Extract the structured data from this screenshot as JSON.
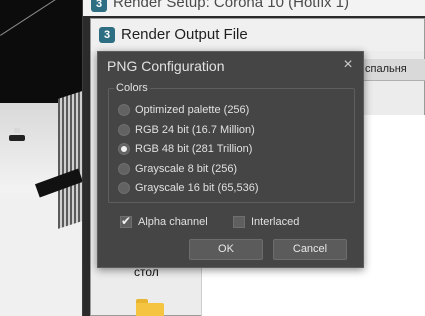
{
  "render_setup": {
    "title": "Render Setup: Corona 10 (Hotfix 1)",
    "icon_text": "3"
  },
  "render_output": {
    "title": "Render Output File",
    "icon_text": "3",
    "tab_text": "спальня",
    "desktop_label": "стол"
  },
  "png_config": {
    "title": "PNG Configuration",
    "colors_label": "Colors",
    "options": [
      {
        "label": "Optimized palette  (256)",
        "checked": false
      },
      {
        "label": "RGB 24 bit  (16.7 Million)",
        "checked": false
      },
      {
        "label": "RGB 48 bit  (281 Trillion)",
        "checked": true
      },
      {
        "label": "Grayscale 8 bit  (256)",
        "checked": false
      },
      {
        "label": "Grayscale 16 bit  (65,536)",
        "checked": false
      }
    ],
    "alpha_label": "Alpha channel",
    "alpha_checked": true,
    "interlaced_label": "Interlaced",
    "interlaced_checked": false,
    "ok_label": "OK",
    "cancel_label": "Cancel"
  },
  "icons": {
    "close": "×",
    "check": "✔"
  }
}
